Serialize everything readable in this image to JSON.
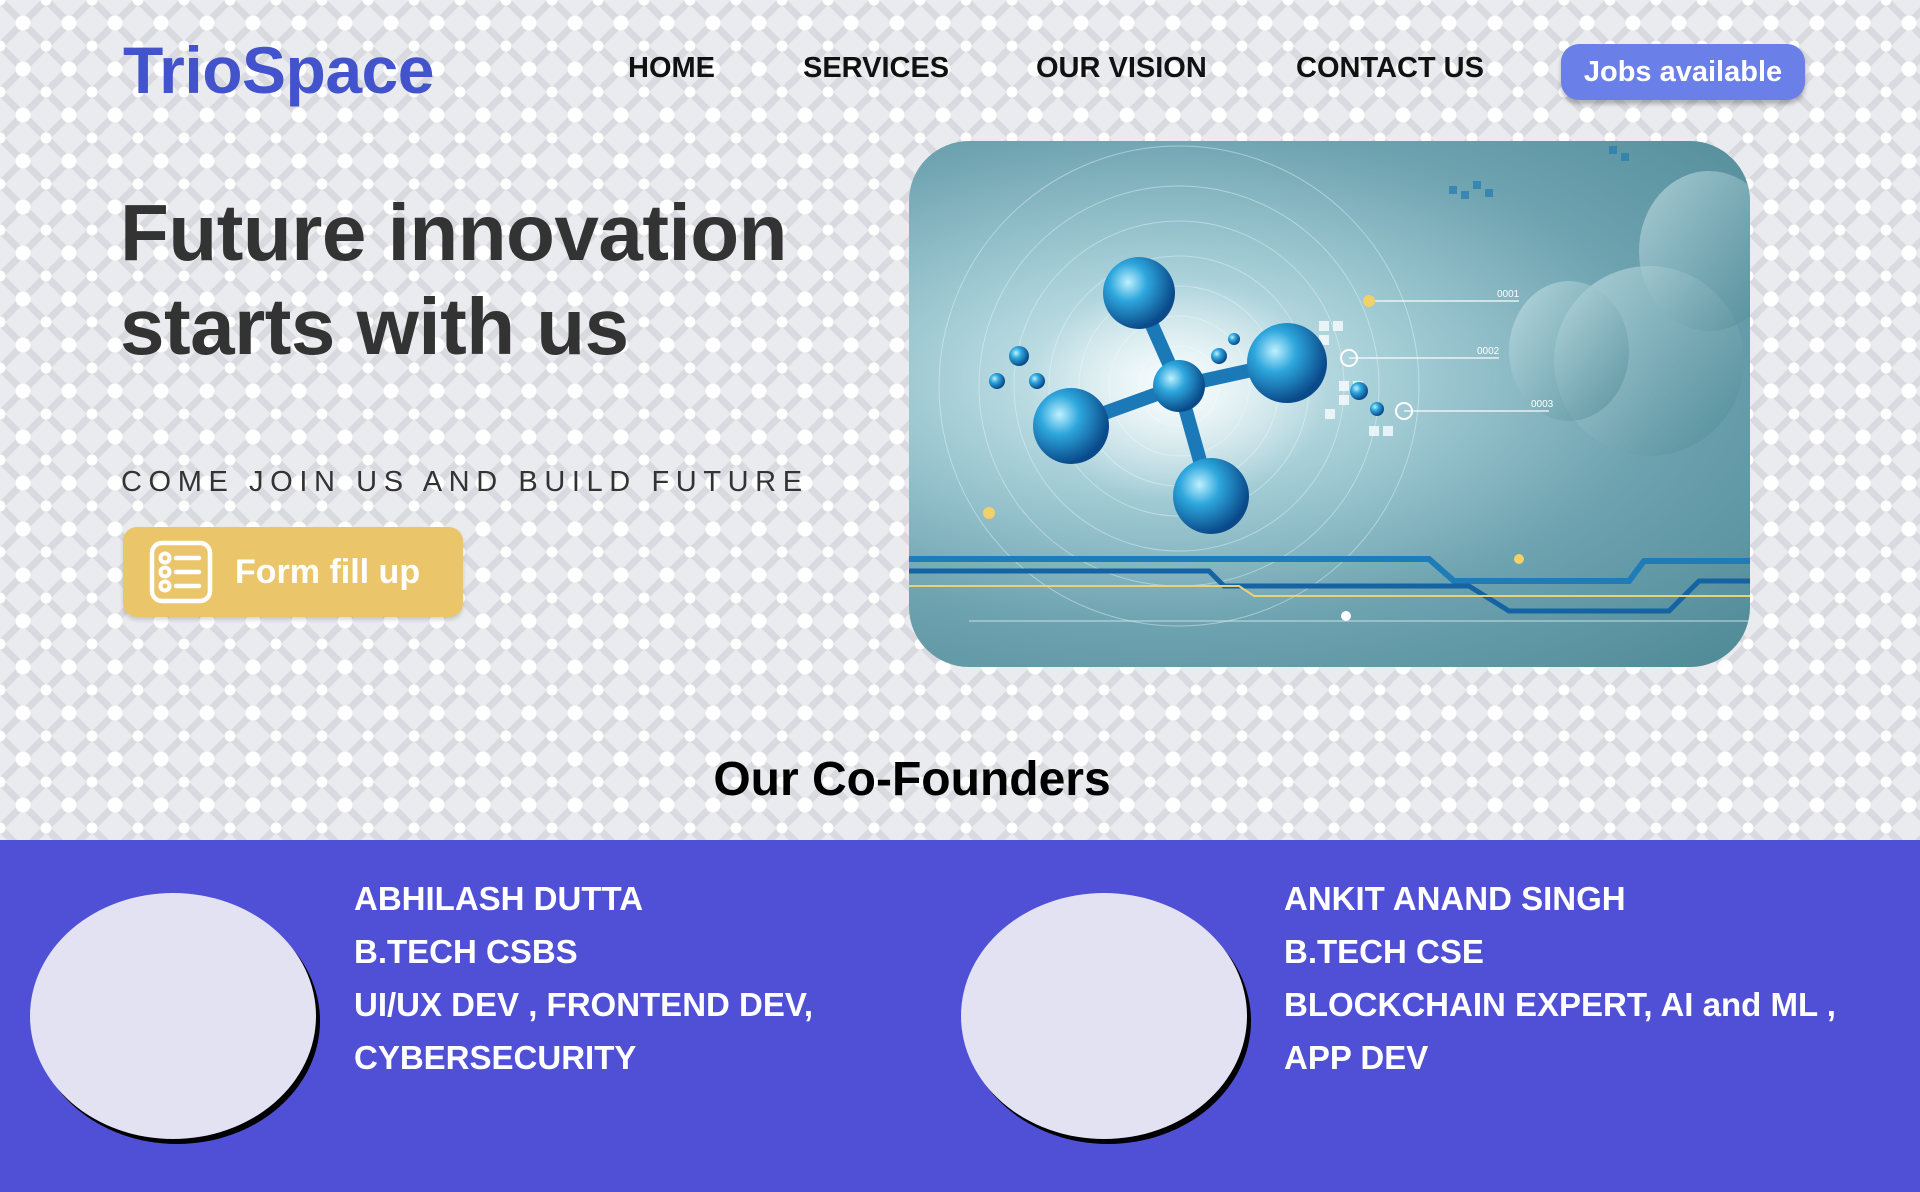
{
  "header": {
    "logo": "TrioSpace",
    "nav": [
      "HOME",
      "SERVICES",
      "OUR VISION",
      "CONTACT US"
    ],
    "jobs_button": "Jobs available"
  },
  "hero": {
    "title": "Future innovation starts with us",
    "subtitle": "COME JOIN US AND BUILD FUTURE",
    "form_button": "Form fill up",
    "image_labels": [
      "0001",
      "0002",
      "0003"
    ]
  },
  "founders": {
    "title": "Our Co-Founders",
    "people": [
      {
        "name": "ABHILASH DUTTA",
        "degree": "B.TECH CSBS",
        "skills_line1": "UI/UX DEV , FRONTEND DEV,",
        "skills_line2": "CYBERSECURITY"
      },
      {
        "name": "ANKIT ANAND SINGH",
        "degree": "B.TECH CSE",
        "skills_line1": "BLOCKCHAIN EXPERT, AI and ML ,",
        "skills_line2": "APP DEV"
      }
    ]
  },
  "colors": {
    "logo": "#4353cc",
    "jobs_button": "#6b7fe8",
    "form_button": "#ebc56a",
    "founders_band": "#5050d7",
    "avatar": "#e3e2f3"
  }
}
